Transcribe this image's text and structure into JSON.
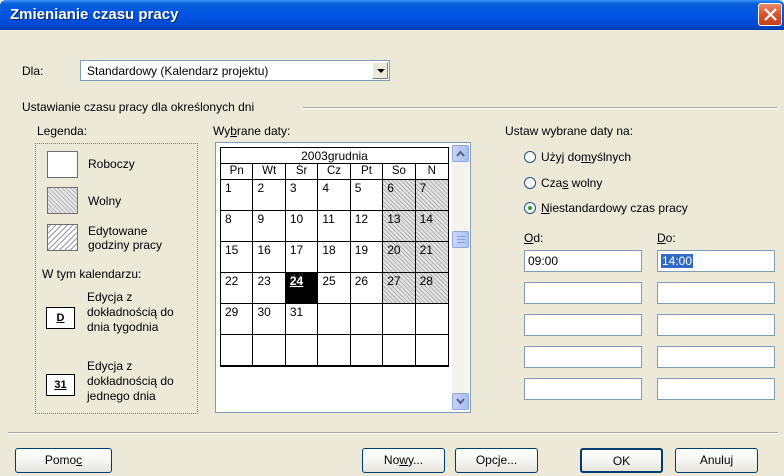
{
  "window": {
    "title": "Zmienianie czasu pracy"
  },
  "dla": {
    "label": "Dla:",
    "value": "Standardowy (Kalendarz projektu)"
  },
  "section_title": "Ustawianie czasu pracy dla określonych dni",
  "legend": {
    "title": "Legenda:",
    "items": [
      "Roboczy",
      "Wolny",
      "Edytowane godziny pracy"
    ],
    "in_calendar": "W tym kalendarzu:",
    "edit_week": {
      "key": "D",
      "text": "Edycja z dokładnością do dnia tygodnia"
    },
    "edit_day": {
      "key": "31",
      "text": "Edycja z dokładnością do jednego dnia"
    }
  },
  "calendar": {
    "label": "Wybrane daty:",
    "header": "2003grudnia",
    "days_of_week": [
      "Pn",
      "Wt",
      "Śr",
      "Cz",
      "Pt",
      "So",
      "N"
    ],
    "weeks": [
      [
        "1",
        "2",
        "3",
        "4",
        "5",
        "6",
        "7"
      ],
      [
        "8",
        "9",
        "10",
        "11",
        "12",
        "13",
        "14"
      ],
      [
        "15",
        "16",
        "17",
        "18",
        "19",
        "20",
        "21"
      ],
      [
        "22",
        "23",
        "24",
        "25",
        "26",
        "27",
        "28"
      ],
      [
        "29",
        "30",
        "31",
        "",
        "",
        "",
        ""
      ],
      [
        "",
        "",
        "",
        "",
        "",
        "",
        ""
      ]
    ],
    "selected_day": "24"
  },
  "set_dates": {
    "title": "Ustaw wybrane daty na:",
    "options": [
      "Użyj domyślnych",
      "Czas wolny",
      "Niestandardowy czas pracy"
    ],
    "selected_index": 2,
    "from_label": "Od:",
    "to_label": "Do:",
    "from_values": [
      "09:00",
      "",
      "",
      "",
      ""
    ],
    "to_values": [
      "14:00",
      "",
      "",
      "",
      ""
    ]
  },
  "buttons": {
    "help": "Pomoc",
    "new": "Nowy...",
    "options": "Opcje...",
    "ok": "OK",
    "cancel": "Anuluj"
  }
}
